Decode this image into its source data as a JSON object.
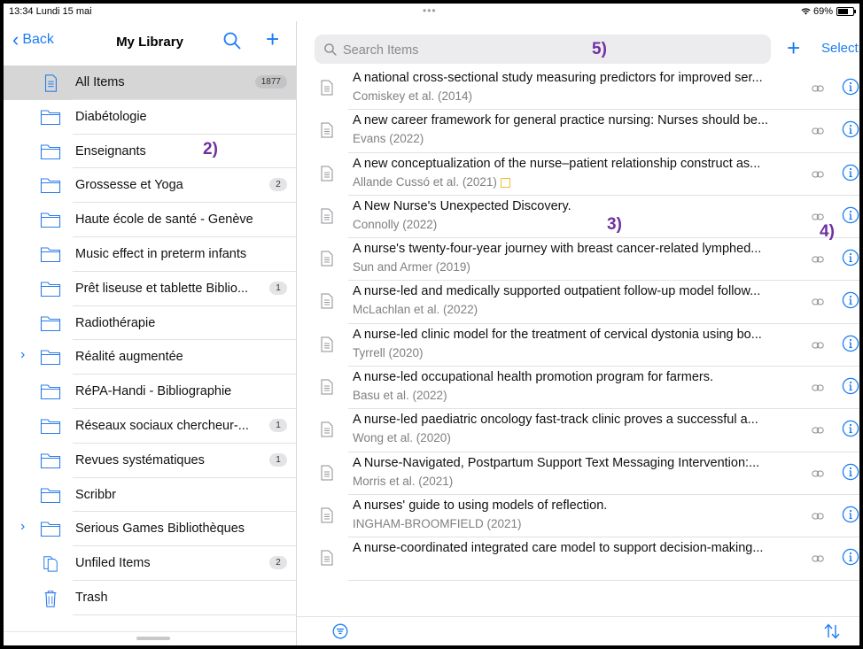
{
  "status_bar": {
    "time_date": "13:34  Lundi 15 mai",
    "dots": "•••",
    "battery": "69%",
    "battery_level": 0.69
  },
  "sidebar": {
    "back_label": "Back",
    "title": "My Library",
    "items": [
      {
        "label": "All Items",
        "count": "1877",
        "icon": "document-icon",
        "selected": true
      },
      {
        "label": "Diabétologie",
        "icon": "folder-icon"
      },
      {
        "label": "Enseignants",
        "icon": "folder-icon"
      },
      {
        "label": "Grossesse et Yoga",
        "count": "2",
        "icon": "folder-icon"
      },
      {
        "label": "Haute école de santé - Genève",
        "icon": "folder-icon"
      },
      {
        "label": "Music effect in preterm infants",
        "icon": "folder-icon"
      },
      {
        "label": "Prêt liseuse et tablette Biblio...",
        "count": "1",
        "icon": "folder-icon"
      },
      {
        "label": "Radiothérapie",
        "icon": "folder-icon"
      },
      {
        "label": "Réalité augmentée",
        "icon": "folder-icon",
        "expandable": true
      },
      {
        "label": "RéPA-Handi - Bibliographie",
        "icon": "folder-icon"
      },
      {
        "label": "Réseaux sociaux chercheur-...",
        "count": "1",
        "icon": "folder-icon"
      },
      {
        "label": "Revues systématiques",
        "count": "1",
        "icon": "folder-icon"
      },
      {
        "label": "Scribbr",
        "icon": "folder-icon"
      },
      {
        "label": "Serious Games Bibliothèques",
        "icon": "folder-icon",
        "expandable": true
      },
      {
        "label": "Unfiled Items",
        "count": "2",
        "icon": "unfiled-icon"
      },
      {
        "label": "Trash",
        "icon": "trash-icon"
      }
    ]
  },
  "main": {
    "search_placeholder": "Search Items",
    "select_label": "Select",
    "items": [
      {
        "title": "A national cross-sectional study measuring predictors for improved ser...",
        "creator": "Comiskey et al. (2014)"
      },
      {
        "title": "A new career framework for general practice nursing: Nurses should be...",
        "creator": "Evans (2022)"
      },
      {
        "title": "A new conceptualization of the nurse–patient relationship construct as...",
        "creator": "Allande Cussó et al. (2021)",
        "has_note": true
      },
      {
        "title": "A New Nurse's Unexpected Discovery.",
        "creator": "Connolly (2022)"
      },
      {
        "title": "A nurse's twenty-four-year journey with breast cancer-related lymphed...",
        "creator": "Sun and Armer (2019)"
      },
      {
        "title": "A nurse-led and medically supported outpatient follow-up model follow...",
        "creator": "McLachlan et al. (2022)"
      },
      {
        "title": "A nurse-led clinic model for the treatment of cervical dystonia using bo...",
        "creator": "Tyrrell (2020)"
      },
      {
        "title": "A nurse-led occupational health promotion program for farmers.",
        "creator": "Basu et al. (2022)"
      },
      {
        "title": "A nurse-led paediatric oncology fast-track clinic proves a successful a...",
        "creator": "Wong et al. (2020)"
      },
      {
        "title": "A Nurse-Navigated, Postpartum Support Text Messaging Intervention:...",
        "creator": "Morris et al. (2021)"
      },
      {
        "title": "A nurses' guide to using models of reflection.",
        "creator": "INGHAM-BROOMFIELD (2021)"
      },
      {
        "title": "A nurse-coordinated integrated care model to support decision-making...",
        "creator": ""
      }
    ]
  },
  "annotations": {
    "a2": "2)",
    "a3": "3)",
    "a4": "4)",
    "a5": "5)"
  },
  "colors": {
    "accent": "#1b7cf4",
    "annotation": "#7030a0",
    "selected_row": "#d6d6d6",
    "note": "#f3b92b"
  }
}
